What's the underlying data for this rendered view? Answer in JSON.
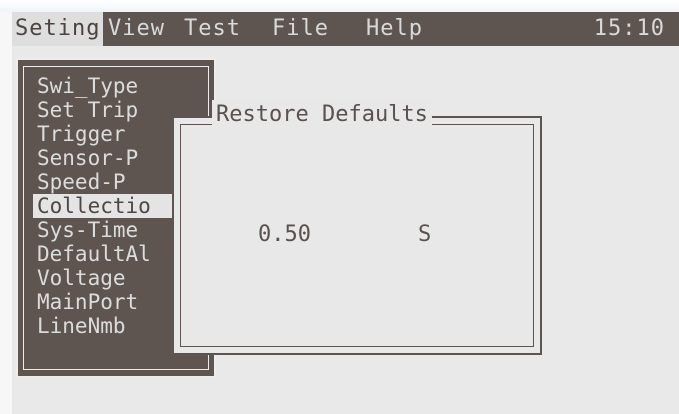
{
  "menubar": {
    "items": [
      "Seting",
      "View",
      "Test",
      "File",
      "Help"
    ],
    "active": "Seting",
    "clock": "15:10"
  },
  "sidebar": {
    "items": [
      "Swi_Type",
      "Set Trip",
      "Trigger",
      "Sensor-P",
      "Speed-P",
      "Collectio",
      "Sys-Time",
      "DefaultAl",
      "Voltage",
      "MainPort",
      "LineNmb"
    ],
    "selected_index": 5
  },
  "dialog": {
    "title": "Restore Defaults",
    "value": "0.50",
    "unit": "S"
  },
  "colors": {
    "lcd_dark": "#5e5450",
    "lcd_light": "#e9e9e9"
  }
}
